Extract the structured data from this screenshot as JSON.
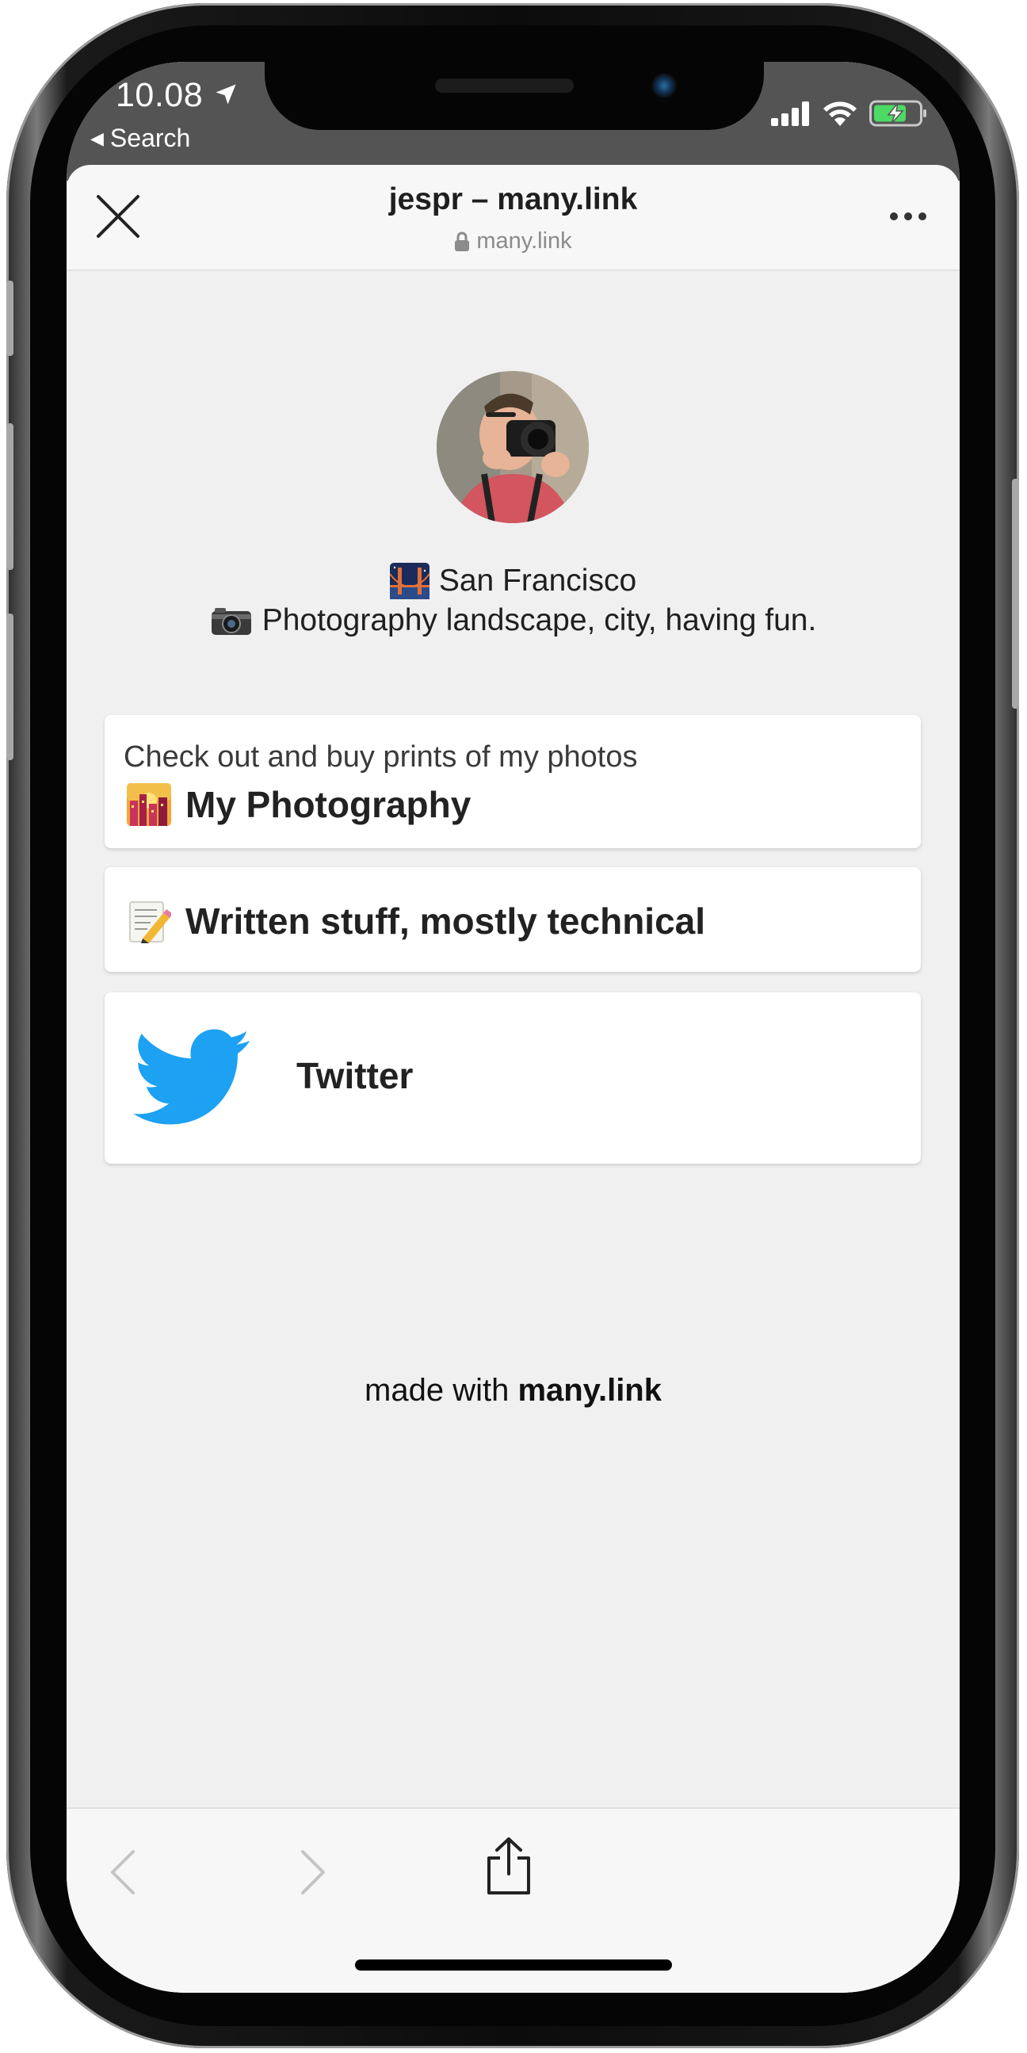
{
  "status_bar": {
    "time": "10.08",
    "back_app": "Search"
  },
  "browser": {
    "title": "jespr – many.link",
    "url": "many.link"
  },
  "profile": {
    "location": "San Francisco",
    "bio": "Photography landscape, city, having fun."
  },
  "links": [
    {
      "subtitle": "Check out and buy prints of my photos",
      "title": "My Photography"
    },
    {
      "title": "Written stuff, mostly technical"
    },
    {
      "title": "Twitter"
    }
  ],
  "footer": {
    "prefix": "made with ",
    "brand": "many.link"
  },
  "icons": {
    "location": "location-arrow-icon",
    "signal": "signal-bars-icon",
    "wifi": "wifi-icon",
    "battery": "battery-charging-icon",
    "close": "close-icon",
    "more": "more-dots-icon",
    "lock": "lock-icon",
    "back": "chevron-left-icon",
    "forward": "chevron-right-icon",
    "share": "share-icon",
    "twitter": "twitter-bird-icon"
  },
  "colors": {
    "status_bar_bg": "#545454",
    "page_bg": "#f0f0f0",
    "card_bg": "#ffffff",
    "twitter_blue": "#1da1f2",
    "battery_green": "#4cd964"
  }
}
